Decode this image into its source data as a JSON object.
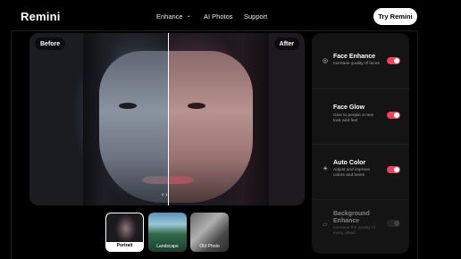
{
  "nav": {
    "logo": "Remini",
    "links": [
      {
        "label": "Enhance",
        "dropdown": true
      },
      {
        "label": "AI Photos"
      },
      {
        "label": "Support"
      }
    ],
    "cta": "Try Remini"
  },
  "compare": {
    "before_label": "Before",
    "after_label": "After",
    "handle": "‹ ›"
  },
  "features": [
    {
      "title": "Face Enhance",
      "desc": "Increase quality of faces",
      "icon": "face-icon",
      "enabled": true
    },
    {
      "title": "Face Glow",
      "desc": "Give to people a new look and feel",
      "icon": "none",
      "enabled": true
    },
    {
      "title": "Auto Color",
      "desc": "Adjust and improve colors and tones",
      "icon": "sun-icon",
      "enabled": true
    },
    {
      "title": "Background Enhance",
      "desc": "Increase the quality of every detail",
      "icon": "image-icon",
      "enabled": false
    }
  ],
  "thumbnails": [
    {
      "label": "Portrait",
      "selected": true
    },
    {
      "label": "Landscape",
      "selected": false
    },
    {
      "label": "Old Photo",
      "selected": false
    }
  ],
  "colors": {
    "accent": "#f0405a",
    "background": "#000000",
    "panel": "#141414"
  }
}
